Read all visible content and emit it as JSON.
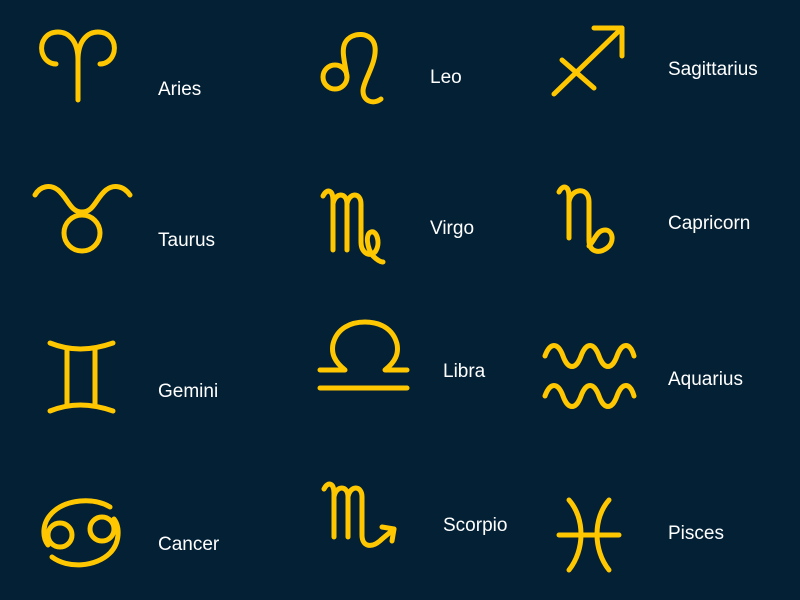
{
  "colors": {
    "background": "#032035",
    "symbol": "#FFC700",
    "text": "#FFFFFF"
  },
  "signs": [
    {
      "name": "Aries",
      "icon": "aries-icon"
    },
    {
      "name": "Taurus",
      "icon": "taurus-icon"
    },
    {
      "name": "Gemini",
      "icon": "gemini-icon"
    },
    {
      "name": "Cancer",
      "icon": "cancer-icon"
    },
    {
      "name": "Leo",
      "icon": "leo-icon"
    },
    {
      "name": "Virgo",
      "icon": "virgo-icon"
    },
    {
      "name": "Libra",
      "icon": "libra-icon"
    },
    {
      "name": "Scorpio",
      "icon": "scorpio-icon"
    },
    {
      "name": "Sagittarius",
      "icon": "sagittarius-icon"
    },
    {
      "name": "Capricorn",
      "icon": "capricorn-icon"
    },
    {
      "name": "Aquarius",
      "icon": "aquarius-icon"
    },
    {
      "name": "Pisces",
      "icon": "pisces-icon"
    }
  ]
}
